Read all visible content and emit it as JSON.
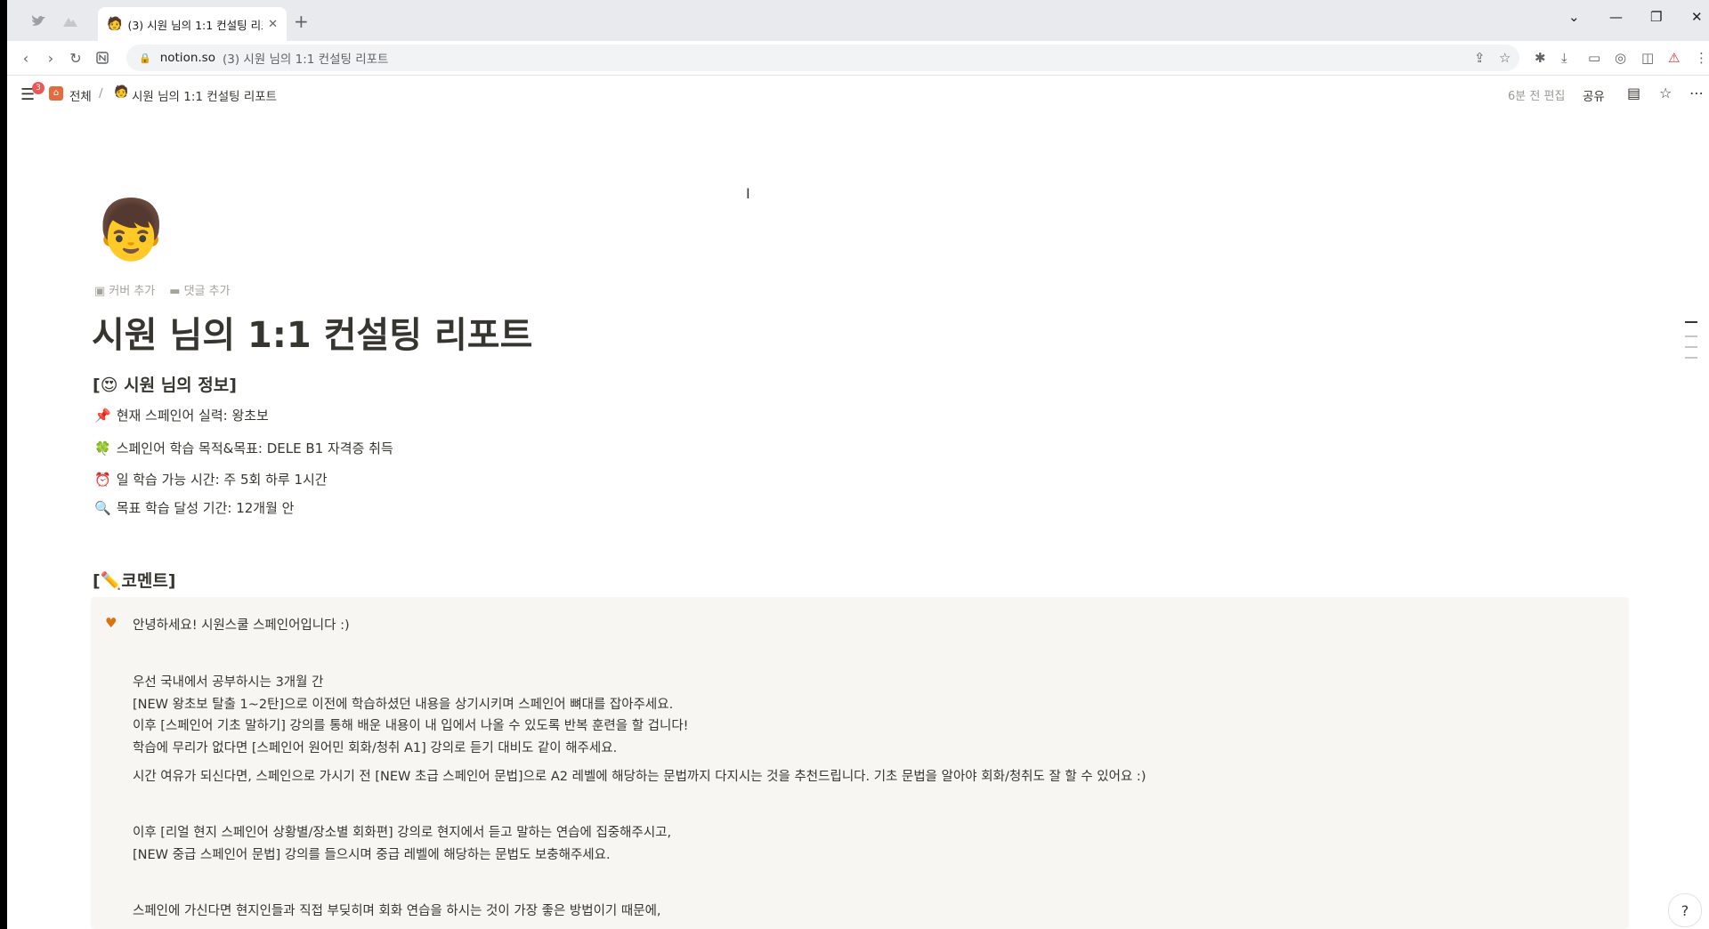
{
  "browser": {
    "active_tab": {
      "favicon": "🧑",
      "title": "(3) 시원 님의 1:1 컨설팅 리포트",
      "close_icon": "✕"
    },
    "new_tab_icon": "+",
    "url": {
      "domain": "notion.so",
      "page_title": "(3) 시원 님의 1:1 컨설팅 리포트"
    }
  },
  "notion": {
    "badge_count": "3",
    "breadcrumb": {
      "workspace": "전체",
      "separator": "/",
      "page_icon": "🧑",
      "page": "시원 님의 1:1 컨설팅 리포트"
    },
    "edited_label": "6분 전 편집",
    "share_label": "공유"
  },
  "page": {
    "emoji": "👦",
    "add_cover": "커버 추가",
    "add_comment": "댓글 추가",
    "title": "시원 님의 1:1 컨설팅 리포트",
    "info_heading": {
      "prefix": "[",
      "emoji": "😍",
      "text": " 시원 님의 정보]"
    },
    "info_lines": [
      {
        "emoji": "📌",
        "text": "현재 스페인어 실력: 왕초보"
      },
      {
        "emoji": "🍀",
        "text": "스페인어 학습 목적&목표: DELE B1 자격증 취득"
      },
      {
        "emoji": "⏰",
        "text": "일 학습 가능 시간: 주 5회 하루 1시간"
      },
      {
        "emoji": "🔍",
        "text": "목표 학습 달성 기간: 12개월 안"
      }
    ],
    "comment_heading": {
      "prefix": "[",
      "emoji": "✏️",
      "text": "코멘트]"
    },
    "callout": {
      "icon": "♥",
      "lines": [
        "안녕하세요! 시원스쿨 스페인어입니다 :)",
        "우선 국내에서 공부하시는 3개월 간",
        "[NEW 왕초보 탈출 1~2탄]으로 이전에 학습하셨던 내용을 상기시키며 스페인어 뼈대를 잡아주세요.",
        "이후 [스페인어 기초 말하기] 강의를 통해 배운 내용이 내 입에서 나올 수 있도록 반복 훈련을 할 겁니다!",
        "학습에 무리가 없다면 [스페인어 원어민 회화/청취 A1] 강의로 듣기 대비도 같이 해주세요.",
        "시간 여유가 되신다면, 스페인으로 가시기 전 [NEW 초급 스페인어 문법]으로 A2 레벨에 해당하는 문법까지 다지시는 것을 추천드립니다. 기초 문법을 알아야 회화/청취도 잘 할 수 있어요 :)",
        "이후 [리얼 현지 스페인어 상황별/장소별 회화편] 강의로 현지에서 듣고 말하는 연습에 집중해주시고,",
        "[NEW 중급 스페인어 문법] 강의를 들으시며 중급 레벨에 해당하는 문법도 보충해주세요.",
        "스페인에 가신다면 현지인들과 직접 부딪히며 회화 연습을 하시는 것이 가장 좋은 방법이기 때문에,"
      ]
    }
  }
}
